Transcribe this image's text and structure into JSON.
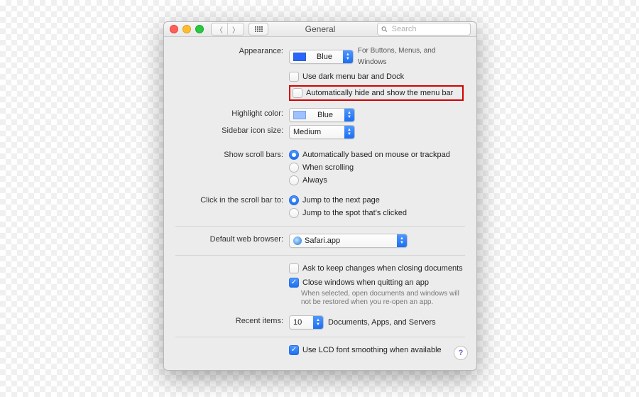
{
  "window": {
    "title": "General"
  },
  "search": {
    "placeholder": "Search"
  },
  "labels": {
    "appearance": "Appearance:",
    "highlight": "Highlight color:",
    "sidebar": "Sidebar icon size:",
    "scrollbars": "Show scroll bars:",
    "clickscroll": "Click in the scroll bar to:",
    "browser": "Default web browser:",
    "recent": "Recent items:"
  },
  "appearance": {
    "value": "Blue",
    "hint": "For Buttons, Menus, and Windows",
    "dark_cb": "Use dark menu bar and Dock",
    "autohide_cb": "Automatically hide and show the menu bar"
  },
  "highlight": {
    "value": "Blue"
  },
  "sidebar": {
    "value": "Medium"
  },
  "scrollbars": {
    "opt1": "Automatically based on mouse or trackpad",
    "opt2": "When scrolling",
    "opt3": "Always"
  },
  "clickscroll": {
    "opt1": "Jump to the next page",
    "opt2": "Jump to the spot that's clicked"
  },
  "browser": {
    "value": "Safari.app"
  },
  "docs": {
    "ask": "Ask to keep changes when closing documents",
    "close": "Close windows when quitting an app",
    "note": "When selected, open documents and windows will not be restored when you re-open an app."
  },
  "recent": {
    "value": "10",
    "suffix": "Documents, Apps, and Servers"
  },
  "lcd": {
    "label": "Use LCD font smoothing when available"
  },
  "help": "?"
}
